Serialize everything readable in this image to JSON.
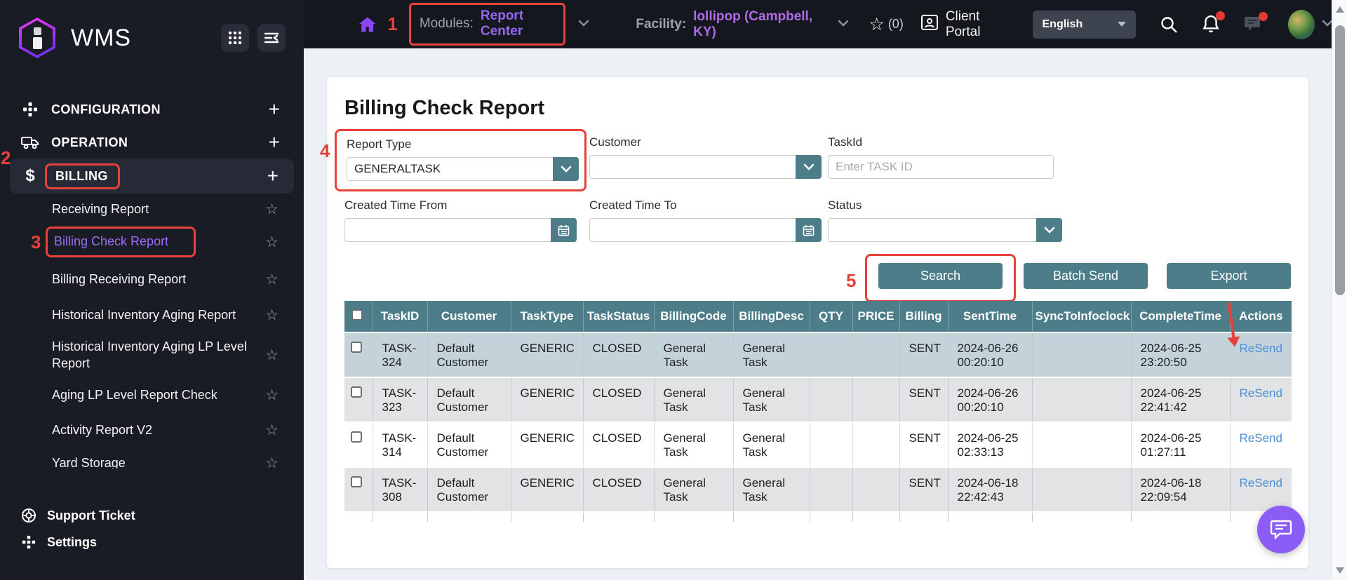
{
  "colors": {
    "accent_teal": "#4d7d89",
    "header_teal": "#4e7d8a",
    "purple": "#8b5cf6",
    "annotation_red": "#e8413a",
    "link_blue": "#4c8fd6",
    "row_blue": "#c3d3d9",
    "row_gray": "#e2e3e4"
  },
  "topbar": {
    "modules_label": "Modules:",
    "modules_value": "Report Center",
    "facility_label": "Facility:",
    "facility_value": "lollipop  (Campbell, KY)",
    "favorites_count": "(0)",
    "client_portal_label": "Client Portal",
    "language": "English"
  },
  "sidebar": {
    "brand": "WMS",
    "sections": {
      "configuration": "CONFIGURATION",
      "operation": "OPERATION",
      "billing": "BILLING"
    },
    "billing_items": [
      "Receiving Report",
      "Billing Check Report",
      "Billing Receiving Report",
      "Historical Inventory Aging Report",
      "Historical Inventory Aging LP Level Report",
      "Aging LP Level Report Check",
      "Activity Report V2",
      "Yard Storage"
    ],
    "footer": {
      "support": "Support Ticket",
      "settings": "Settings"
    }
  },
  "page_title": "Billing Check Report",
  "filters": {
    "report_type": {
      "label": "Report Type",
      "value": "GENERALTASK"
    },
    "customer": {
      "label": "Customer",
      "value": ""
    },
    "task_id": {
      "label": "TaskId",
      "placeholder": "Enter TASK ID",
      "value": ""
    },
    "created_from": {
      "label": "Created Time From",
      "value": ""
    },
    "created_to": {
      "label": "Created Time To",
      "value": ""
    },
    "status": {
      "label": "Status",
      "value": ""
    }
  },
  "actions": {
    "search": "Search",
    "batch_send": "Batch Send",
    "export": "Export"
  },
  "annotations": {
    "n1": "1",
    "n2": "2",
    "n3": "3",
    "n4": "4",
    "n5": "5"
  },
  "table": {
    "columns": [
      "TaskID",
      "Customer",
      "TaskType",
      "TaskStatus",
      "BillingCode",
      "BillingDesc",
      "QTY",
      "PRICE",
      "Billing",
      "SentTime",
      "SyncToInfoclock",
      "CompleteTime",
      "Actions"
    ],
    "rows": [
      {
        "task_id": "TASK-324",
        "customer": "Default Customer",
        "task_type": "GENERIC",
        "task_status": "CLOSED",
        "billing_code": "General Task",
        "billing_desc": "General Task",
        "qty": "",
        "price": "",
        "billing": "SENT",
        "sent_time": "2024-06-26 00:20:10",
        "sync_to_infoclock": "",
        "complete_time": "2024-06-25 23:20:50",
        "action": "ReSend",
        "shade": "blue"
      },
      {
        "task_id": "TASK-323",
        "customer": "Default Customer",
        "task_type": "GENERIC",
        "task_status": "CLOSED",
        "billing_code": "General Task",
        "billing_desc": "General Task",
        "qty": "",
        "price": "",
        "billing": "SENT",
        "sent_time": "2024-06-26 00:20:10",
        "sync_to_infoclock": "",
        "complete_time": "2024-06-25 22:41:42",
        "action": "ReSend",
        "shade": "gray"
      },
      {
        "task_id": "TASK-314",
        "customer": "Default Customer",
        "task_type": "GENERIC",
        "task_status": "CLOSED",
        "billing_code": "General Task",
        "billing_desc": "General Task",
        "qty": "",
        "price": "",
        "billing": "SENT",
        "sent_time": "2024-06-25 02:33:13",
        "sync_to_infoclock": "",
        "complete_time": "2024-06-25 01:27:11",
        "action": "ReSend",
        "shade": "white"
      },
      {
        "task_id": "TASK-308",
        "customer": "Default Customer",
        "task_type": "GENERIC",
        "task_status": "CLOSED",
        "billing_code": "General Task",
        "billing_desc": "General Task",
        "qty": "",
        "price": "",
        "billing": "SENT",
        "sent_time": "2024-06-18 22:42:43",
        "sync_to_infoclock": "",
        "complete_time": "2024-06-18 22:09:54",
        "action": "ReSend",
        "shade": "gray"
      }
    ]
  }
}
